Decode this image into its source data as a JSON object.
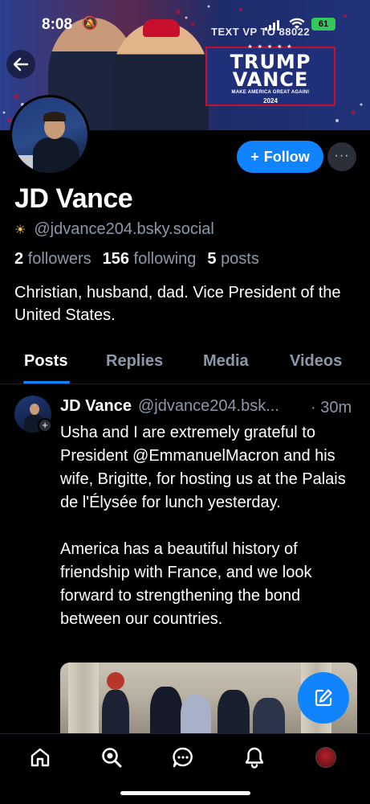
{
  "status_bar": {
    "time": "8:08",
    "battery": "61"
  },
  "banner": {
    "side_text": "TEXT VP TO 88022",
    "sign_stars": "★ ★ ★ ★ ★",
    "sign_title_1": "TRUMP",
    "sign_title_2": "VANCE",
    "sign_subtitle": "MAKE AMERICA GREAT AGAIN!",
    "sign_year": "2024"
  },
  "profile": {
    "display_name": "JD Vance",
    "handle": "@jdvance204.bsky.social",
    "followers_count": "2",
    "followers_label": "followers",
    "following_count": "156",
    "following_label": "following",
    "posts_count": "5",
    "posts_label": "posts",
    "bio": "Christian, husband, dad. Vice President of the United States."
  },
  "actions": {
    "follow_label": "Follow",
    "more_label": "···"
  },
  "tabs": [
    {
      "label": "Posts",
      "active": true
    },
    {
      "label": "Replies",
      "active": false
    },
    {
      "label": "Media",
      "active": false
    },
    {
      "label": "Videos",
      "active": false
    }
  ],
  "post": {
    "author": "JD Vance",
    "handle": "@jdvance204.bsk...",
    "time": "· 30m",
    "paragraph_1": "Usha and I are extremely grateful to President @EmmanuelMacron and his wife, Brigitte, for hosting us at the Palais de l'Élysée for lunch yesterday.",
    "paragraph_2": "America has a beautiful history of friendship with France, and we look forward to strengthening the bond between our countries."
  },
  "bottom_nav": [
    "home-icon",
    "search-icon",
    "chat-icon",
    "bell-icon",
    "profile-avatar"
  ],
  "colors": {
    "accent": "#1083fe",
    "muted": "#8b98a9",
    "background": "#000000"
  }
}
